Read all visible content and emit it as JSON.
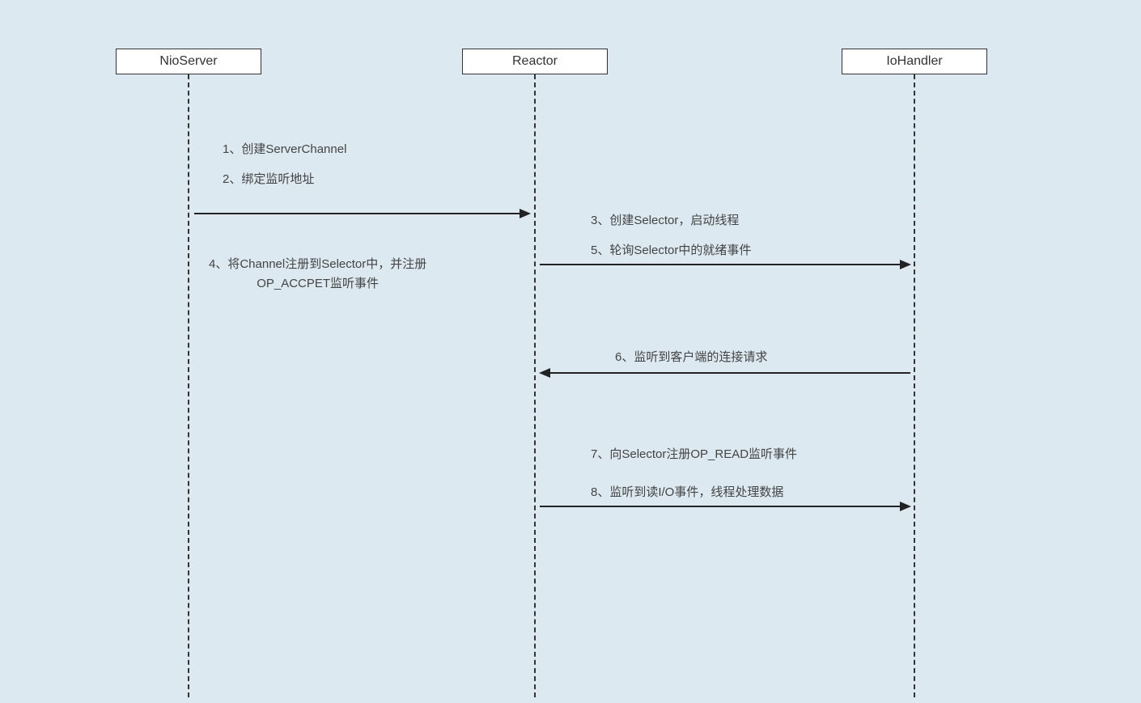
{
  "participants": {
    "p1": "NioServer",
    "p2": "Reactor",
    "p3": "IoHandler"
  },
  "messages": {
    "m1": "1、创建ServerChannel",
    "m2": "2、绑定监听地址",
    "m3": "3、创建Selector，启动线程",
    "m4": "4、将Channel注册到Selector中，并注册\nOP_ACCPET监听事件",
    "m5": "5、轮询Selector中的就绪事件",
    "m6": "6、监听到客户端的连接请求",
    "m7": "7、向Selector注册OP_READ监听事件",
    "m8": "8、监听到读I/O事件，线程处理数据"
  }
}
